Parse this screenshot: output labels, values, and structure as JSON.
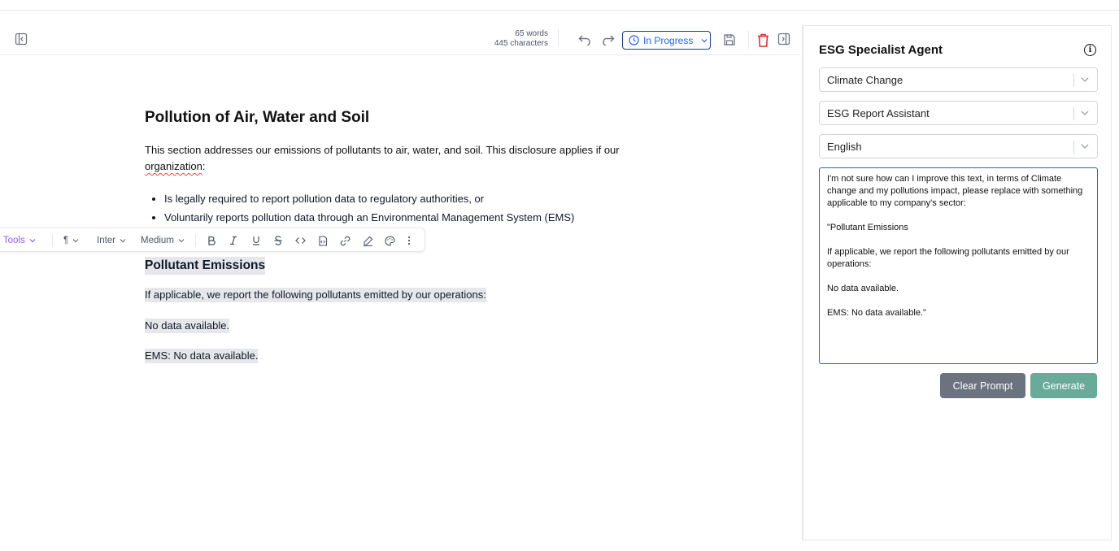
{
  "toolbar": {
    "words": "65 words",
    "characters": "445 characters",
    "status": "In Progress"
  },
  "format_bar": {
    "ai_tools": "AI Tools",
    "paragraph": "¶",
    "font": "Inter",
    "weight": "Medium"
  },
  "document": {
    "title": "Pollution of Air, Water and Soil",
    "intro_part1": "This section addresses our emissions of pollutants to air, water, and soil. This disclosure applies if our",
    "intro_part2": "organization",
    "intro_part3": ":",
    "bullets": [
      "Is legally required to report pollution data to regulatory authorities, or",
      "Voluntarily reports pollution data through an Environmental Management System (EMS)"
    ],
    "section_title": "Pollutant Emissions",
    "section_intro": "If applicable, we report the following pollutants emitted by our operations:",
    "no_data": "No data available.",
    "ems_line": "EMS: No data available."
  },
  "panel": {
    "title": "ESG Specialist Agent",
    "topic_select": "Climate Change",
    "assistant_select": "ESG Report Assistant",
    "language_select": "English",
    "prompt_text": "I'm not sure how can I improve this text, in terms of Climate change and my pollutions impact, please replace with something applicable to my company's sector:\n\n\"Pollutant Emissions\n\nIf applicable, we report the following pollutants emitted by our operations:\n\nNo data available.\n\nEMS: No data available.\"",
    "clear_button": "Clear Prompt",
    "generate_button": "Generate"
  }
}
